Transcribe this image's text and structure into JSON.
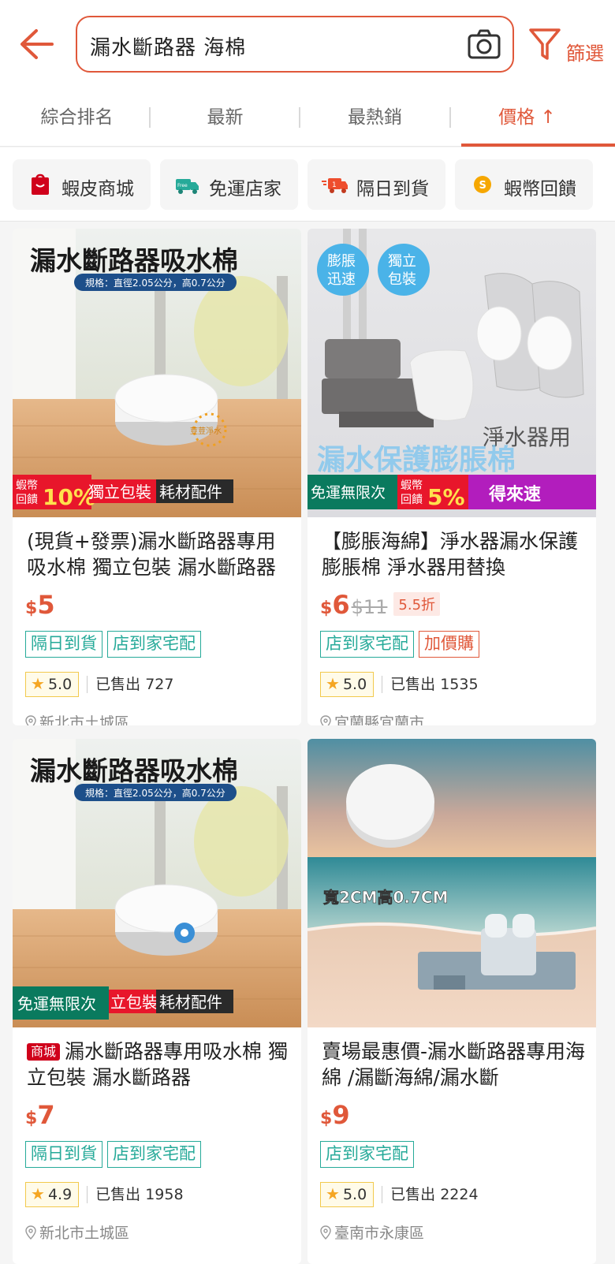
{
  "search": {
    "query": "漏水斷路器 海棉",
    "filter_label": "篩選"
  },
  "sort_tabs": [
    {
      "label": "綜合排名"
    },
    {
      "label": "最新"
    },
    {
      "label": "最熱銷"
    },
    {
      "label": "價格 ↑"
    }
  ],
  "filter_chips": [
    {
      "label": "蝦皮商城",
      "icon": "shopee-mall-bag-icon"
    },
    {
      "label": "免運店家",
      "icon": "free-shipping-truck-icon"
    },
    {
      "label": "隔日到貨",
      "icon": "next-day-delivery-truck-icon"
    },
    {
      "label": "蝦幣回饋",
      "icon": "shopee-coin-icon"
    }
  ],
  "products": [
    {
      "image_headline": "漏水斷路器吸水棉",
      "image_spec": "規格：直徑2.05公分，高0.7公分",
      "image_brand": "荳荳淨水",
      "banner_left_a": "蝦幣",
      "banner_left_b": "回饋",
      "banner_left_big": "10%",
      "banner_mid": "獨立包裝",
      "banner_right": "耗材配件",
      "title": "(現貨+發票)漏水斷路器專用吸水棉 獨立包裝 漏水斷路器",
      "currency": "$",
      "price": "5",
      "tags": [
        "隔日到貨",
        "店到家宅配"
      ],
      "rating": "5.0",
      "sold": "已售出 727",
      "location": "新北市土城區"
    },
    {
      "image_bubble1": "膨脹迅速",
      "image_bubble2": "獨立包裝",
      "image_caption": "淨水器用",
      "image_headline": "漏水保護膨脹棉",
      "banner_free": "免運無限次",
      "banner_coin_a": "蝦幣",
      "banner_coin_b": "回饋",
      "banner_coin_big": "5%",
      "banner_right": "得來速",
      "title": "【膨脹海綿】淨水器漏水保護膨脹棉 淨水器用替換",
      "currency": "$",
      "price": "6",
      "original_price": "$11",
      "discount": "5.5折",
      "tags": [
        "店到家宅配",
        "加價購"
      ],
      "rating": "5.0",
      "sold": "已售出 1535",
      "location": "宜蘭縣宜蘭市"
    },
    {
      "image_headline": "漏水斷路器吸水棉",
      "image_spec": "規格：直徑2.05公分，高0.7公分",
      "banner_free": "免運無限次",
      "banner_mid": "立包裝",
      "banner_right": "耗材配件",
      "badge": "商城",
      "title": "漏水斷路器專用吸水棉 獨立包裝 漏水斷路器",
      "currency": "$",
      "price": "7",
      "tags": [
        "隔日到貨",
        "店到家宅配"
      ],
      "rating": "4.9",
      "sold": "已售出 1958",
      "location": "新北市土城區"
    },
    {
      "image_caption": "寬2CM高0.7CM",
      "title": "賣場最惠價-漏水斷路器專用海綿 /漏斷海綿/漏水斷",
      "currency": "$",
      "price": "9",
      "tags": [
        "店到家宅配"
      ],
      "rating": "5.0",
      "sold": "已售出 2224",
      "location": "臺南市永康區"
    }
  ],
  "colors": {
    "accent": "#e0583a",
    "teal": "#26aa99",
    "mall_red": "#d0011b",
    "star": "#f5a623"
  }
}
